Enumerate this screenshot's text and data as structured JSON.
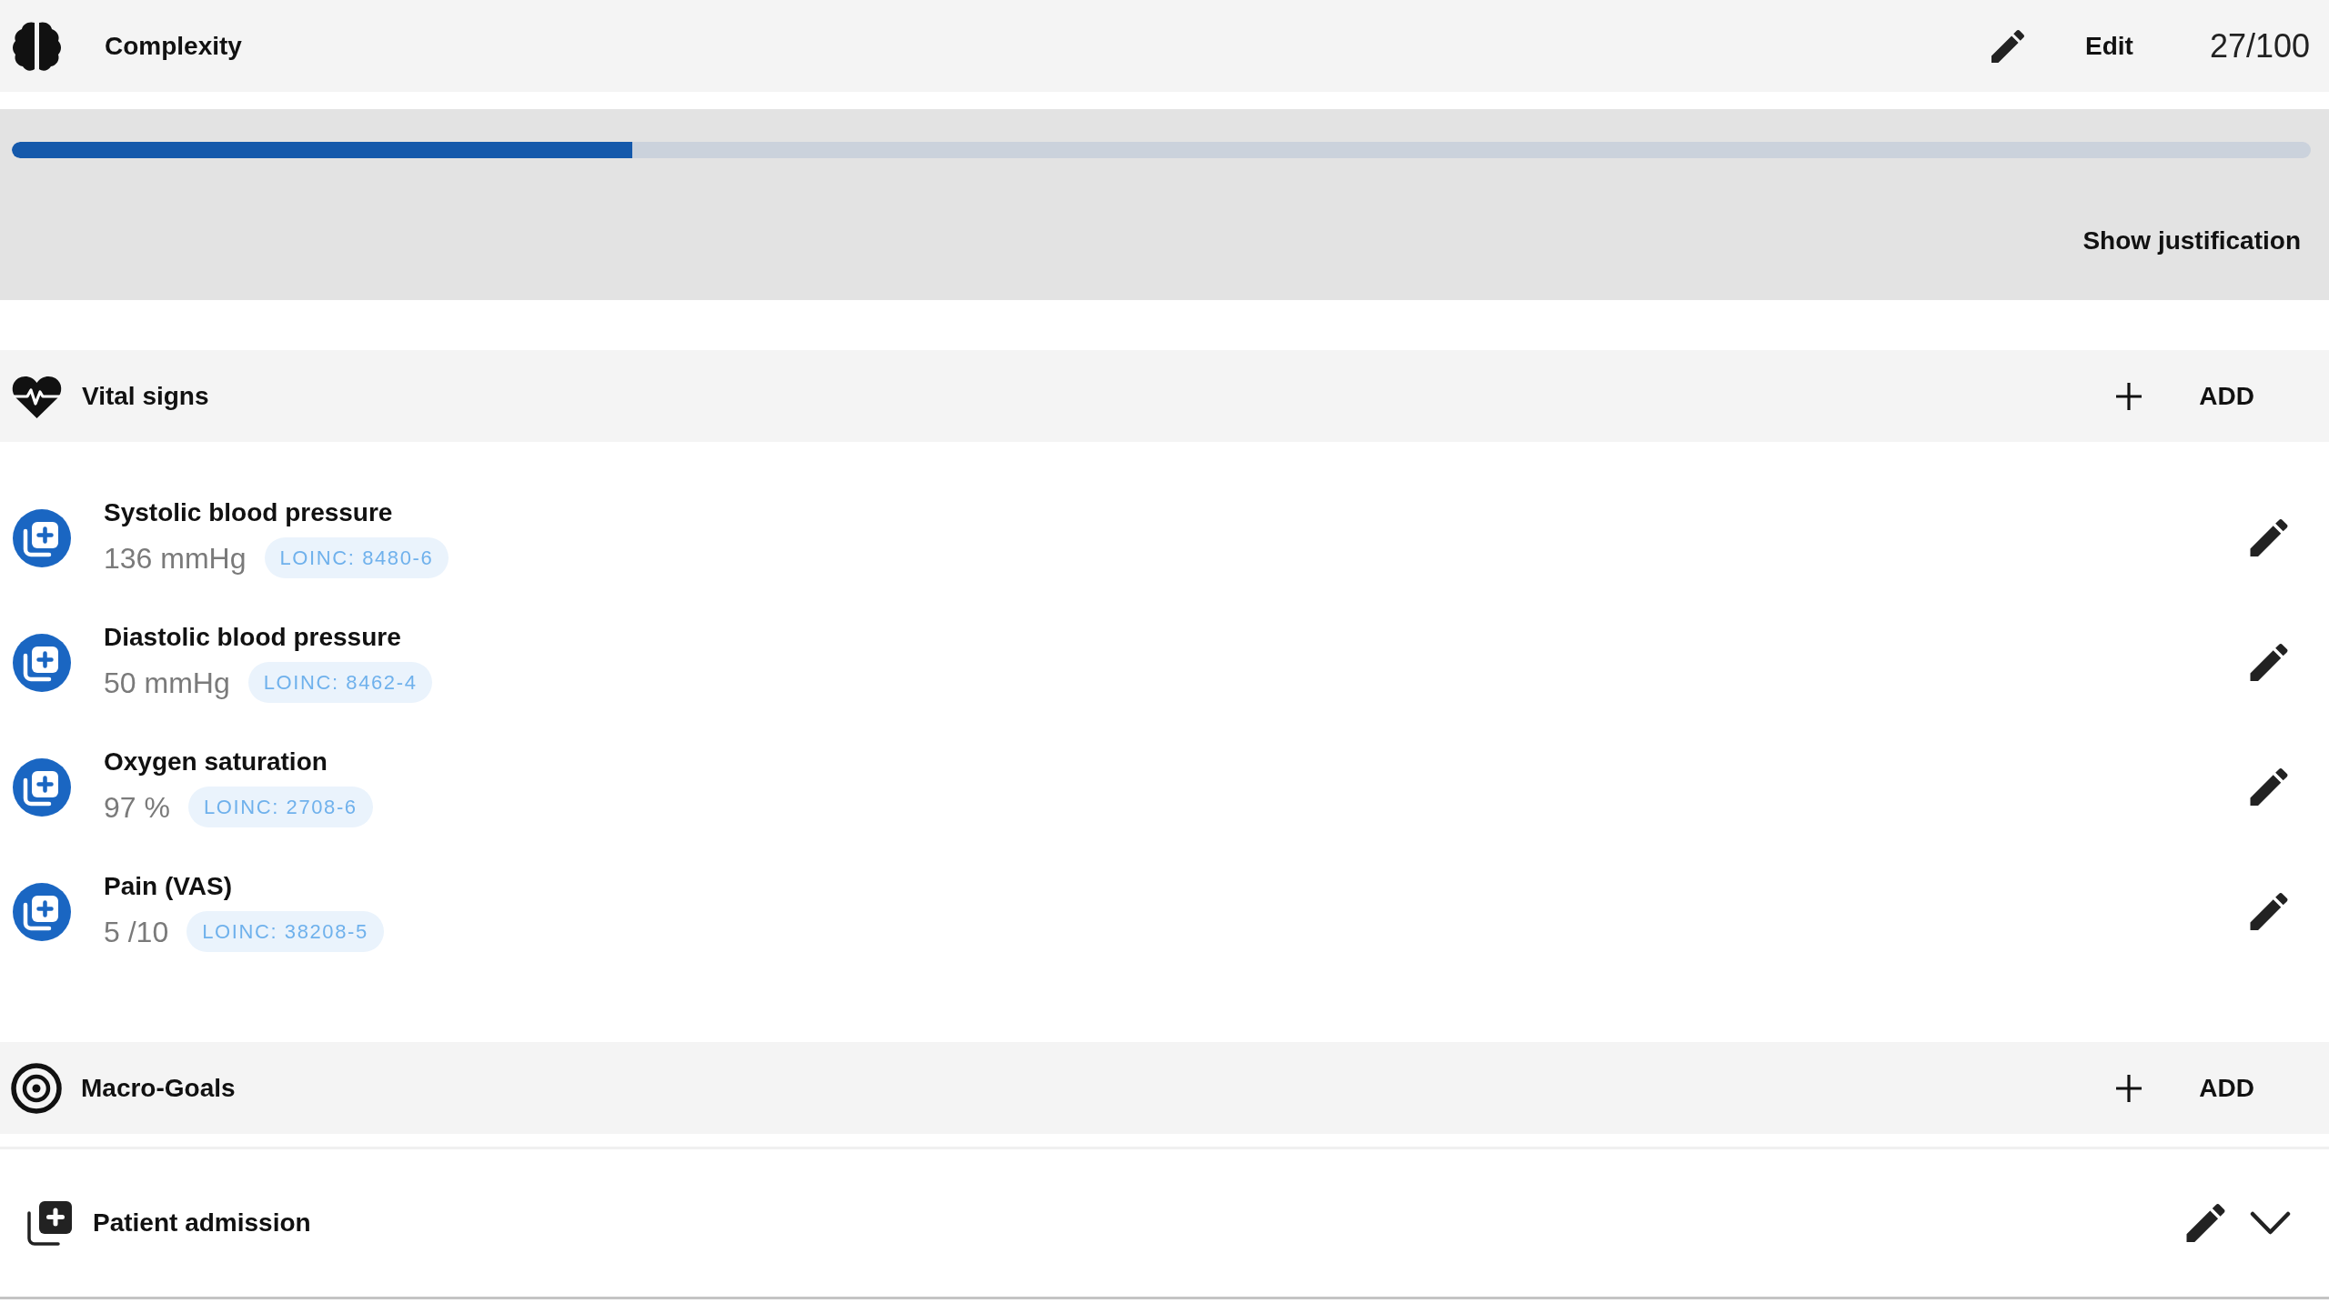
{
  "complexity": {
    "title": "Complexity",
    "edit_label": "Edit",
    "score": "27/100",
    "level": 0.27,
    "justification_link": "Show justification"
  },
  "sections": [
    {
      "kind": "vitals",
      "title": "Vital signs",
      "add_label": "ADD",
      "items": [
        {
          "name": "Systolic blood pressure",
          "value": "136 mmHg",
          "code": "LOINC: 8480-6"
        },
        {
          "name": "Diastolic blood pressure",
          "value": "50 mmHg",
          "code": "LOINC: 8462-4"
        },
        {
          "name": "Oxygen saturation",
          "value": "97 %",
          "code": "LOINC: 2708-6"
        },
        {
          "name": "Pain (VAS)",
          "value": "5 /10",
          "code": "LOINC: 38208-5"
        }
      ]
    },
    {
      "kind": "goals",
      "title": "Macro-Goals",
      "add_label": "ADD"
    }
  ],
  "admission": {
    "title": "Patient admission",
    "expanded": false
  }
}
